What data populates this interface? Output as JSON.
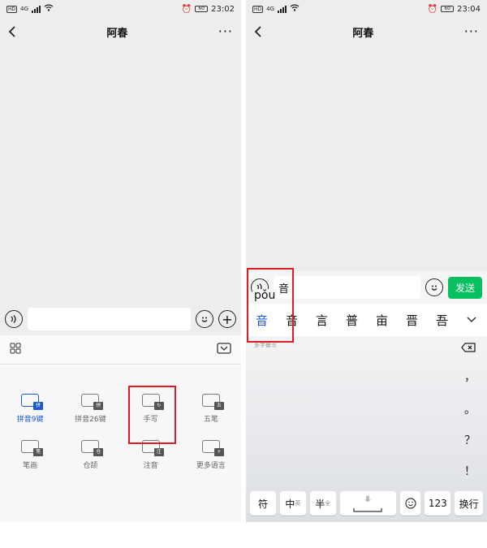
{
  "left": {
    "status": {
      "hd": "HD",
      "net": "4G",
      "time": "23:02",
      "battery": "60"
    },
    "title": "阿春",
    "input_icons": [
      "voice-icon",
      "emoji-icon",
      "plus-icon"
    ],
    "tabs": {
      "left_icon": "grid-icon",
      "right_icon": "collapse-keyboard-icon"
    },
    "keyboards": [
      {
        "label": "拼音9键",
        "badge": "拼",
        "active": true
      },
      {
        "label": "拼音26键",
        "badge": "拼",
        "active": false
      },
      {
        "label": "手写",
        "badge": "↻",
        "active": false
      },
      {
        "label": "五笔",
        "badge": "五",
        "active": false
      },
      {
        "label": "笔画",
        "badge": "笔",
        "active": false
      },
      {
        "label": "仓颉",
        "badge": "仓",
        "active": false
      },
      {
        "label": "注音",
        "badge": "注",
        "active": false
      },
      {
        "label": "更多语言",
        "badge": "+",
        "active": false
      }
    ]
  },
  "right": {
    "status": {
      "hd": "HD",
      "net": "4G",
      "time": "23:04",
      "battery": "60"
    },
    "title": "阿春",
    "input_value": "音",
    "pinyin_popup": "pǒu",
    "send_label": "发送",
    "candidates": [
      "音",
      "音",
      "言",
      "普",
      "亩",
      "晋",
      "吾"
    ],
    "hint": "多字叠写",
    "punct": [
      "，",
      "。",
      "？",
      "！"
    ],
    "keys": {
      "k1": "符",
      "k2": "中",
      "k2_sup": "英",
      "k3": "半",
      "k3_sup": "全",
      "k5": "123",
      "k6": "换行"
    }
  },
  "colors": {
    "accent_blue": "#1a57d6",
    "send_green": "#07c160",
    "highlight_red": "#e01b24"
  }
}
